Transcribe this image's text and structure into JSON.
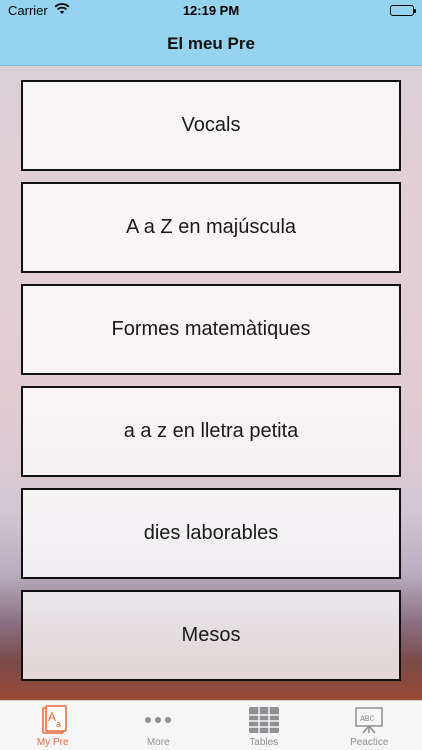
{
  "status_bar": {
    "carrier": "Carrier",
    "time": "12:19 PM"
  },
  "nav": {
    "title": "El meu Pre"
  },
  "menu": {
    "items": [
      {
        "label": "Vocals"
      },
      {
        "label": "A a Z en majúscula"
      },
      {
        "label": "Formes matemàtiques"
      },
      {
        "label": "a a z en lletra petita"
      },
      {
        "label": "dies laborables"
      },
      {
        "label": "Mesos"
      }
    ]
  },
  "tab_bar": {
    "active_color": "#e5683f",
    "tabs": [
      {
        "label": "My Pre",
        "icon": "book-letters-icon",
        "active": true
      },
      {
        "label": "More",
        "icon": "more-dots-icon",
        "active": false
      },
      {
        "label": "Tables",
        "icon": "grid-table-icon",
        "active": false
      },
      {
        "label": "Peactice",
        "icon": "abc-board-icon",
        "active": false
      }
    ]
  }
}
